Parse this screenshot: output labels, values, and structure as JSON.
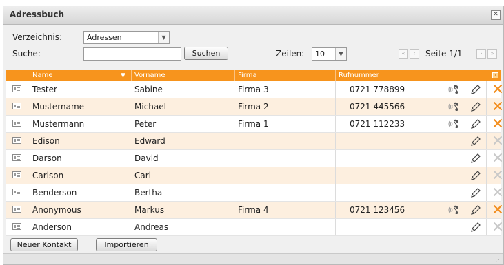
{
  "window": {
    "title": "Adressbuch",
    "close_icon": "close-icon"
  },
  "toolbar": {
    "directory_label": "Verzeichnis:",
    "directory_value": "Adressen",
    "search_label": "Suche:",
    "search_value": "",
    "search_button": "Suchen",
    "rows_label": "Zeilen:",
    "rows_value": "10",
    "page_text": "Seite 1/1"
  },
  "table": {
    "columns": [
      "Name",
      "Vorname",
      "Firma",
      "Rufnummer"
    ],
    "sort_indicator": "▼",
    "rows": [
      {
        "name": "Tester",
        "vorname": "Sabine",
        "firma": "Firma 3",
        "rufnummer": "0721 778899"
      },
      {
        "name": "Mustername",
        "vorname": "Michael",
        "firma": "Firma 2",
        "rufnummer": "0721 445566"
      },
      {
        "name": "Mustermann",
        "vorname": "Peter",
        "firma": "Firma 1",
        "rufnummer": "0721 112233"
      },
      {
        "name": "Edison",
        "vorname": "Edward",
        "firma": "",
        "rufnummer": ""
      },
      {
        "name": "Darson",
        "vorname": "David",
        "firma": "",
        "rufnummer": ""
      },
      {
        "name": "Carlson",
        "vorname": "Carl",
        "firma": "",
        "rufnummer": ""
      },
      {
        "name": "Benderson",
        "vorname": "Bertha",
        "firma": "",
        "rufnummer": ""
      },
      {
        "name": "Anonymous",
        "vorname": "Markus",
        "firma": "Firma 4",
        "rufnummer": "0721 123456"
      },
      {
        "name": "Anderson",
        "vorname": "Andreas",
        "firma": "",
        "rufnummer": ""
      }
    ]
  },
  "footer": {
    "new_contact": "Neuer Kontakt",
    "import": "Importieren"
  },
  "colors": {
    "header_orange": "#f7941d",
    "row_alt": "#fdefdf",
    "delete_active": "#f28c1a",
    "delete_inactive": "#c8c8c8"
  }
}
